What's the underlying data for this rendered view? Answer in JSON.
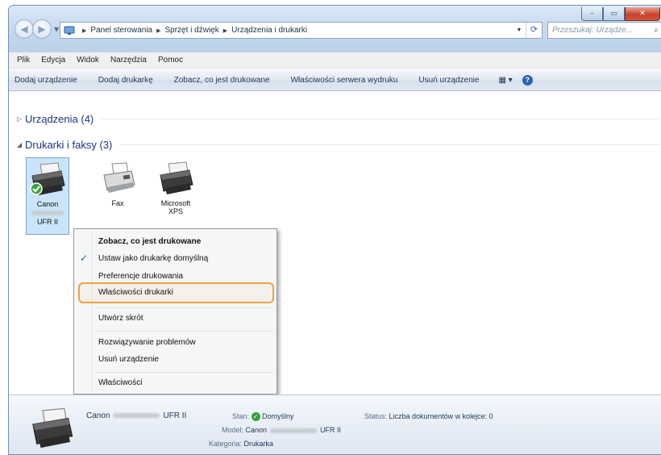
{
  "window": {
    "minimize_label": "–",
    "maximize_label": "▭",
    "close_label": "✕"
  },
  "nav": {
    "back_glyph": "◀",
    "forward_glyph": "▶",
    "dropdown_glyph": "▼"
  },
  "address": {
    "crumbs": [
      "Panel sterowania",
      "Sprzęt i dźwięk",
      "Urządzenia i drukarki"
    ],
    "separator": "▶",
    "refresh_glyph": "⟳"
  },
  "search": {
    "placeholder": "Przeszukaj: Urządze...",
    "icon": "search-icon"
  },
  "menu": [
    "Plik",
    "Edycja",
    "Widok",
    "Narzędzia",
    "Pomoc"
  ],
  "toolbar": {
    "buttons": [
      "Dodaj urządzenie",
      "Dodaj drukarkę",
      "Zobacz, co jest drukowane",
      "Właściwości serwera wydruku",
      "Usuń urządzenie"
    ],
    "view_label": "▦ ▾",
    "help_label": "?"
  },
  "groups": [
    {
      "triangle": "▷",
      "label": "Urządzenia (4)"
    },
    {
      "triangle": "◢",
      "label": "Drukarki i faksy (3)"
    }
  ],
  "devices": [
    {
      "name": "Canon",
      "name2": "UFR II",
      "selected": true
    },
    {
      "name": "Fax"
    },
    {
      "name": "Microsoft",
      "name2": "XPS"
    }
  ],
  "context_menu": {
    "items": [
      "Zobacz, co jest drukowane",
      "Ustaw jako drukarkę domyślną",
      "Preferencje drukowania",
      "Właściwości drukarki",
      "Utwórz skrót",
      "Rozwiązywanie problemów",
      "Usuń urządzenie",
      "Właściwości"
    ],
    "check": "✓",
    "highlight_color": "#f0a23c"
  },
  "details": {
    "name_prefix": "Canon",
    "name_suffix": "UFR II",
    "state_label": "Stan:",
    "state_value": "Domyślny",
    "status_label": "Status:",
    "status_value": "Liczba dokumentów w kolejce: 0",
    "model_label": "Model:",
    "model_prefix": "Canon",
    "model_suffix": "UFR II",
    "category_label": "Kategoria:",
    "category_value": "Drukarka",
    "ok_glyph": "✓"
  }
}
